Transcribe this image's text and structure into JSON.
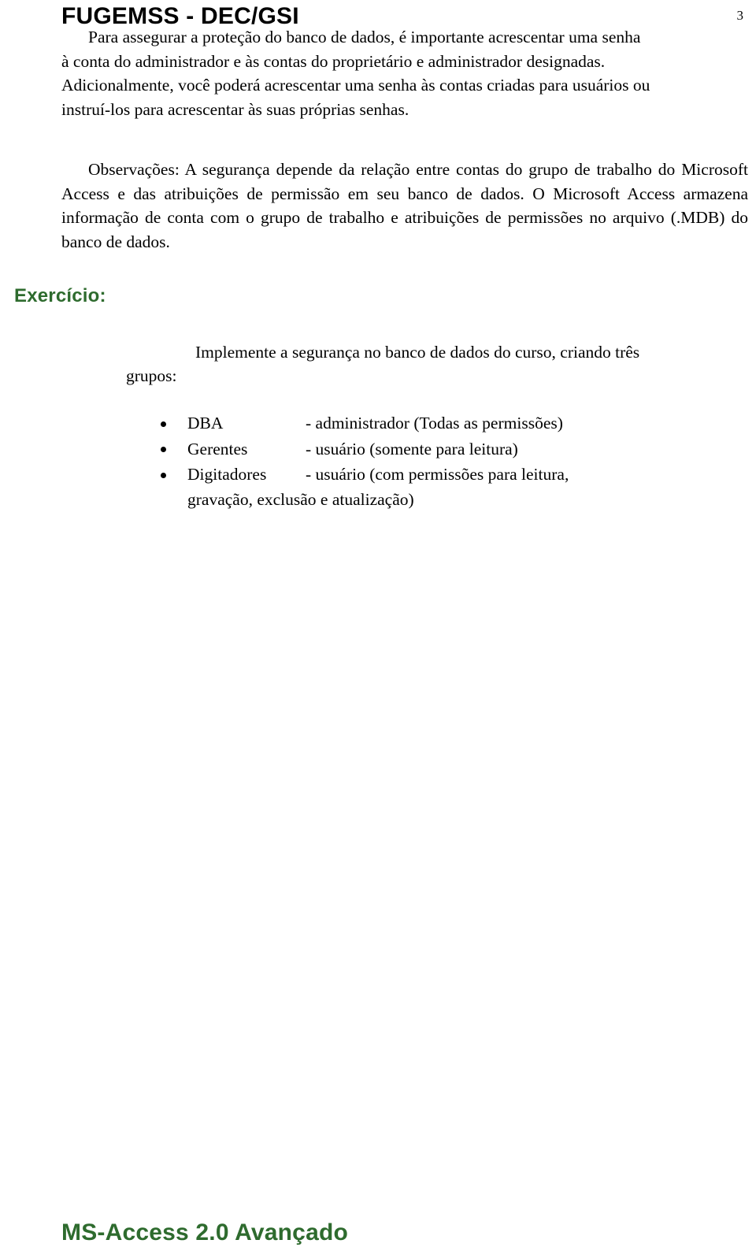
{
  "header": {
    "title": "FUGEMSS - DEC/GSI",
    "page_number": "3"
  },
  "paragraphs": {
    "p1_line1": "Para assegurar a proteção do banco de dados, é importante acrescentar uma senha",
    "p1_line2": "à conta do administrador e às contas do proprietário e administrador designadas.",
    "p1_line3": "Adicionalmente, você poderá acrescentar uma senha às contas criadas para usuários ou",
    "p1_line4": "instruí-los para acrescentar às suas próprias senhas.",
    "p2": "Observações: A segurança depende da relação entre contas do grupo de trabalho do Microsoft Access e das atribuições de permissão em seu banco de dados. O Microsoft Access armazena informação de conta com o grupo de trabalho e atribuições de permissões no arquivo (.MDB) do banco de dados."
  },
  "exercise": {
    "heading": "Exercício:",
    "intro": "Implemente a segurança no banco de dados do curso, criando três",
    "intro_label": "grupos:",
    "items": [
      {
        "name": "DBA",
        "desc": "- administrador (Todas as permissões)"
      },
      {
        "name": "Gerentes",
        "desc": "- usuário        (somente para leitura)"
      },
      {
        "name": "Digitadores",
        "desc": "- usuário              (com  permissões  para  leitura,",
        "desc_cont": "gravação, exclusão e atualização)"
      }
    ]
  },
  "footer": {
    "text": "MS-Access 2.0 Avançado"
  },
  "colors": {
    "accent_green": "#2e6b2e",
    "text": "#000000",
    "background": "#ffffff"
  }
}
